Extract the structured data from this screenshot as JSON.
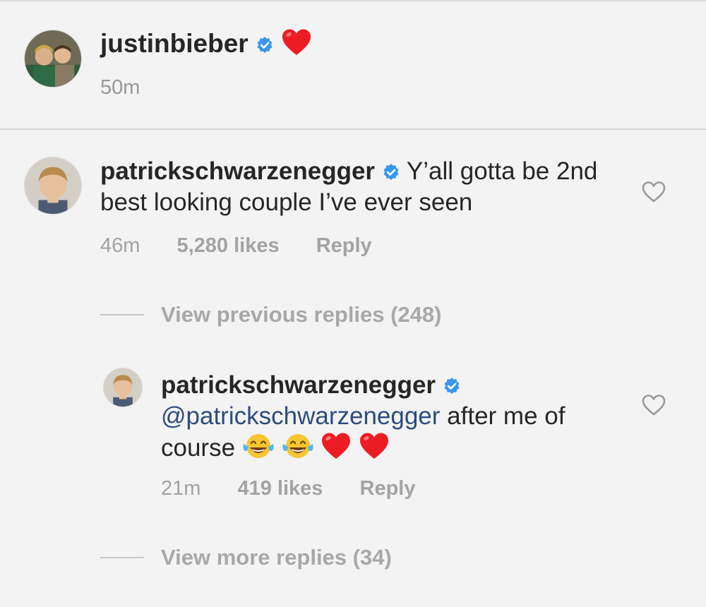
{
  "post": {
    "username": "justinbieber",
    "time": "50m"
  },
  "comment": {
    "username": "patrickschwarzenegger",
    "text": "Y’all gotta be 2nd best looking couple I’ve ever seen",
    "time": "46m",
    "likes": "5,280 likes",
    "reply_label": "Reply"
  },
  "view_previous": "View previous replies (248)",
  "reply": {
    "username": "patrickschwarzenegger",
    "mention": "@patrickschwarzenegger",
    "text": " after me of course ",
    "time": "21m",
    "likes": "419 likes",
    "reply_label": "Reply"
  },
  "view_more": "View more replies (34)",
  "colors": {
    "verified": "#3897f0",
    "heart": "#ed1c24",
    "mention": "#2d4c7e",
    "muted": "#a3a3a3"
  }
}
